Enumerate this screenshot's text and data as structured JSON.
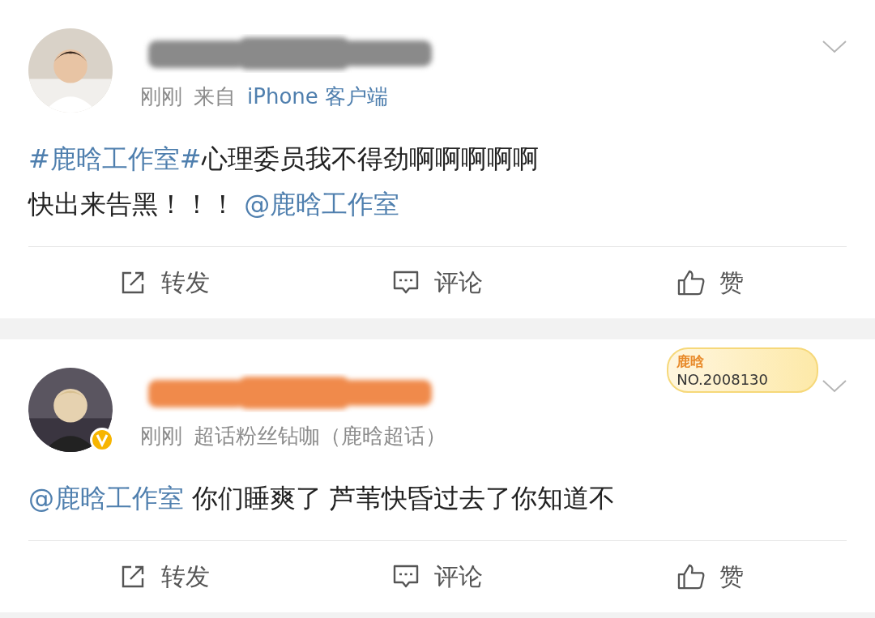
{
  "posts": [
    {
      "user": {
        "color": "#8a8a8a",
        "verified": false
      },
      "meta": [
        {
          "kind": "text",
          "text": "刚刚"
        },
        {
          "kind": "text",
          "text": "来自"
        },
        {
          "kind": "link",
          "text": "iPhone 客户端"
        }
      ],
      "lines": [
        [
          {
            "kind": "link",
            "text": "#鹿晗工作室#"
          },
          {
            "kind": "text",
            "text": "心理委员我不得劲啊啊啊啊啊"
          }
        ],
        [
          {
            "kind": "text",
            "text": "快出来告黑！！！ "
          },
          {
            "kind": "link",
            "text": "@鹿晗工作室"
          }
        ]
      ],
      "actions": [
        {
          "kind": "repost",
          "label": "转发"
        },
        {
          "kind": "comment",
          "label": "评论"
        },
        {
          "kind": "like",
          "label": "赞"
        }
      ]
    },
    {
      "user": {
        "color": "#f08a4b",
        "verified": true
      },
      "fans_badge": {
        "name": "鹿晗",
        "number": "NO.2008130"
      },
      "meta": [
        {
          "kind": "text",
          "text": "刚刚"
        },
        {
          "kind": "text",
          "text": "超话粉丝钻咖（鹿晗超话）"
        }
      ],
      "lines": [
        [
          {
            "kind": "link",
            "text": "@鹿晗工作室"
          },
          {
            "kind": "text",
            "text": " 你们睡爽了 芦苇快昏过去了你知道不"
          }
        ]
      ],
      "actions": [
        {
          "kind": "repost",
          "label": "转发"
        },
        {
          "kind": "comment",
          "label": "评论"
        },
        {
          "kind": "like",
          "label": "赞"
        }
      ]
    }
  ]
}
